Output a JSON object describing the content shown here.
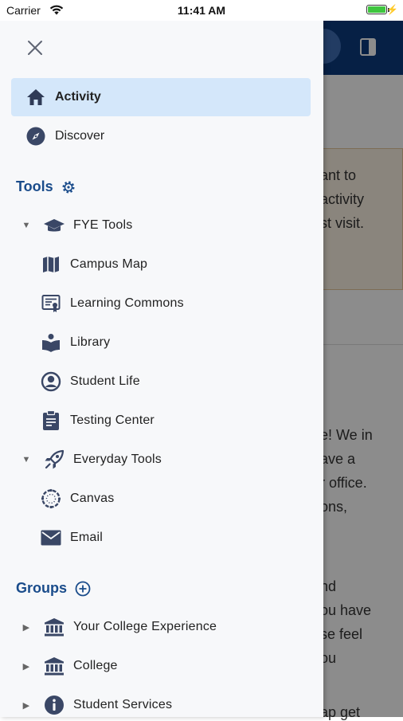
{
  "status_bar": {
    "carrier": "Carrier",
    "time": "11:41 AM",
    "battery_percent": 100
  },
  "background": {
    "lines": [
      "ant to",
      "activity",
      "st visit.",
      "e! We in",
      "ave a",
      "r office.",
      "ons,",
      "nd",
      "ou have",
      "se feel",
      "ou",
      "ap get"
    ]
  },
  "drawer": {
    "nav": [
      {
        "label": "Activity",
        "icon": "home-icon",
        "active": true
      },
      {
        "label": "Discover",
        "icon": "compass-icon",
        "active": false
      }
    ],
    "tools_header": "Tools",
    "tools": {
      "fye_label": "FYE Tools",
      "fye_items": [
        "Campus Map",
        "Learning Commons",
        "Library",
        "Student Life",
        "Testing Center"
      ],
      "everyday_label": "Everyday Tools",
      "everyday_items": [
        "Canvas",
        "Email"
      ]
    },
    "groups_header": "Groups",
    "groups": [
      "Your College Experience",
      "College",
      "Student Services"
    ]
  },
  "colors": {
    "accent": "#1a4c8b",
    "active_bg": "#d4e7fa",
    "icon": "#3a4766",
    "navbar": "#0c3b7e"
  }
}
